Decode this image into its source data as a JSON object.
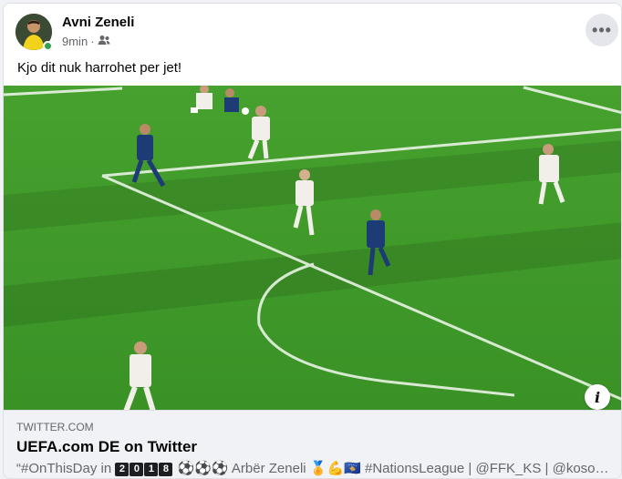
{
  "post": {
    "author": "Avni Zeneli",
    "time": "9min",
    "separator": "·",
    "audience_icon": "friends-icon",
    "text": "Kjo dit nuk harrohet per jet!",
    "more_icon": "more-horizontal-icon"
  },
  "link_preview": {
    "domain": "TWITTER.COM",
    "title": "UEFA.com DE on Twitter",
    "desc_prefix": "“#OnThisDay in",
    "year_digits": [
      "2",
      "0",
      "1",
      "8"
    ],
    "desc_rest": " ⚽⚽⚽ Arbër Zeneli 🏅💪🇽🇰 #NationsLeague | @FFK_KS | @koso…"
  },
  "colors": {
    "accent": "#1877f2",
    "pitch_green": "#3f9a2a",
    "online": "#31a24c"
  }
}
